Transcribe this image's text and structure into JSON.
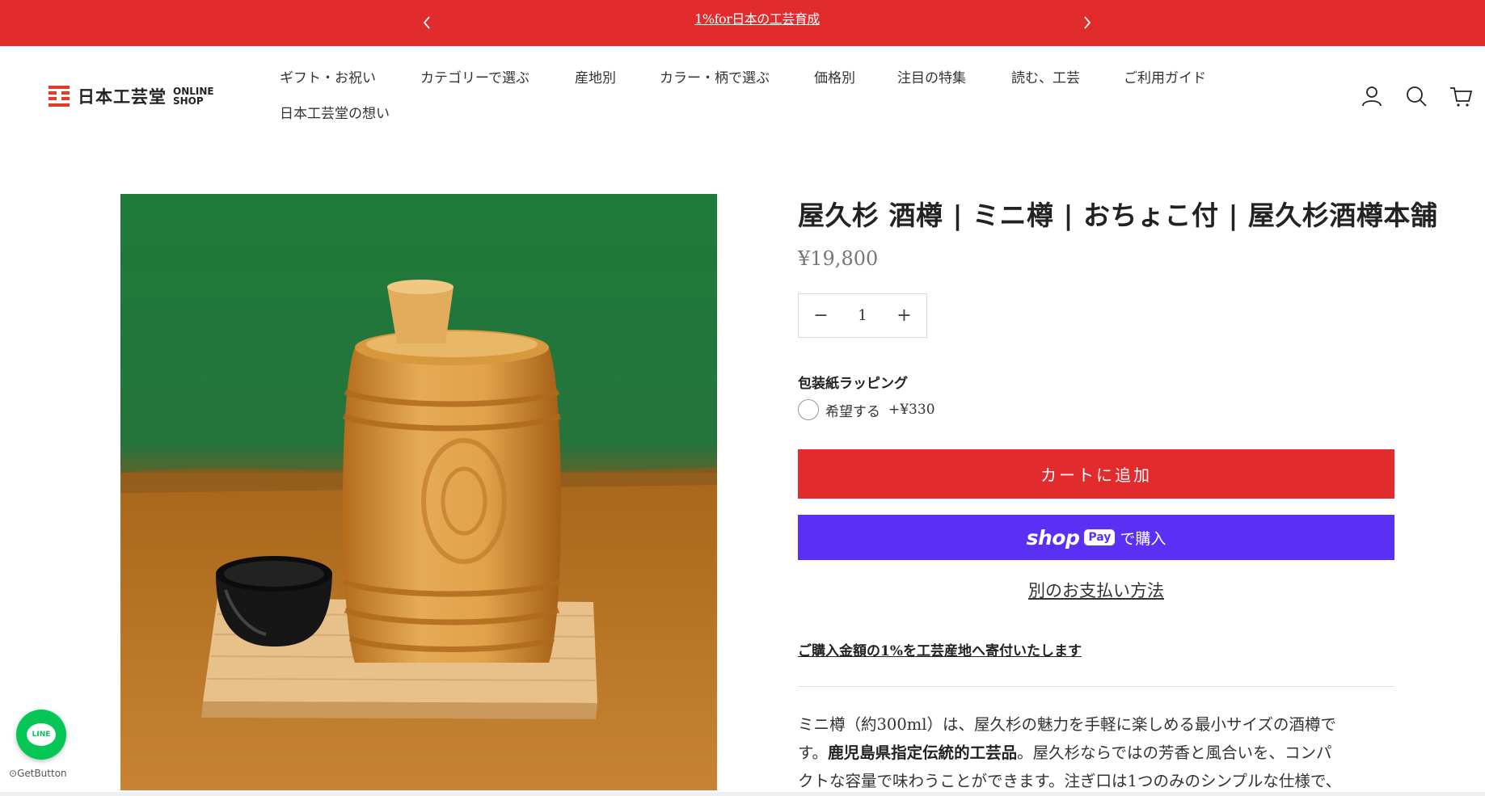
{
  "announcement": {
    "message": "1%for日本の工芸育成",
    "prev_label": "‹",
    "next_label": "›"
  },
  "brand": {
    "logo_text": "日本工芸堂",
    "logo_sub_line1": "ONLINE",
    "logo_sub_line2": "SHOP",
    "logo_color": "#e33a2c"
  },
  "nav": {
    "items": [
      {
        "label": "ギフト・お祝い"
      },
      {
        "label": "カテゴリーで選ぶ"
      },
      {
        "label": "産地別"
      },
      {
        "label": "カラー・柄で選ぶ"
      },
      {
        "label": "価格別"
      },
      {
        "label": "注目の特集"
      },
      {
        "label": "読む、工芸"
      },
      {
        "label": "ご利用ガイド"
      },
      {
        "label": "日本工芸堂の想い"
      }
    ]
  },
  "header_icons": [
    "account-icon",
    "search-icon",
    "cart-icon"
  ],
  "product": {
    "title": "屋久杉 酒樽 | ミニ樽 | おちょこ付 | 屋久杉酒樽本舗",
    "price": "¥19,800",
    "quantity": {
      "minus": "−",
      "value": "1",
      "plus": "+"
    },
    "wrapping": {
      "label": "包装紙ラッピング",
      "option_label": "希望する",
      "option_fee": "+¥330"
    },
    "add_to_cart": "カートに追加",
    "shop_pay": {
      "shop": "shop",
      "pay": "Pay",
      "suffix": "で購入"
    },
    "alt_payment": "別のお支払い方法",
    "donation_link": "ご購入金額の1%を工芸産地へ寄付いたします",
    "description": {
      "line1": "ミニ樽（約300ml）は、屋久杉の魅力を手軽に楽しめる最小サイズの酒樽で",
      "line2_a": "す。",
      "line2_b": "鹿児島県指定伝統的工芸品",
      "line2_c": "。屋久杉ならではの芳香と風合いを、コンパ",
      "line3": "クトな容量で味わうことができます。注ぎ口は1つのみのシンプルな仕様で、"
    }
  },
  "floating": {
    "line_label": "LINE",
    "getbutton_label": "GetButton"
  },
  "colors": {
    "accent_red": "#e12b2d",
    "shop_pay_purple": "#5a31f4",
    "line_green": "#06c755"
  }
}
